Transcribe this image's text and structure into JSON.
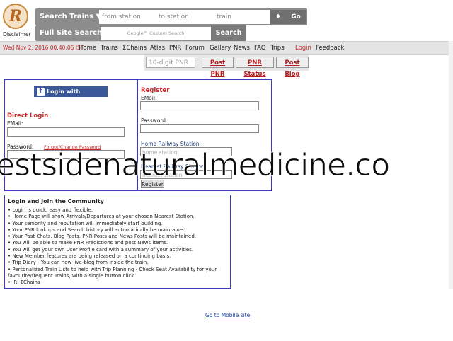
{
  "header": {
    "logo_letter": "R",
    "disclaimer": "Disclaimer",
    "search_trains_label": "Search Trains ▼",
    "from_placeholder": "from station",
    "to_placeholder": "to station",
    "train_placeholder": "train",
    "swap_label": "♦",
    "go_label": "Go",
    "full_site_search_label": "Full Site Search",
    "google_search_placeholder": "Google™ Custom Search",
    "search_button": "Search"
  },
  "nav": {
    "datetime": "Wed Nov 2, 2016 00:40:06 IST",
    "items": [
      "Home",
      "Trains",
      "ΣChains",
      "Atlas",
      "PNR",
      "Forum",
      "Gallery",
      "News",
      "FAQ",
      "Trips"
    ],
    "login": "Login",
    "feedback": "Feedback"
  },
  "pnr": {
    "placeholder": "10-digit PNR",
    "post_pnr": "Post PNR",
    "pnr_status": "PNR Status",
    "post_blog": "Post Blog"
  },
  "login": {
    "facebook_button": "Login with Facebook",
    "direct_login": "Direct Login",
    "email_label": "EMail:",
    "password_label": "Password:",
    "forgot": "Forgot/Change Password"
  },
  "register": {
    "heading": "Register",
    "email_label": "EMail:",
    "password_label": "Password:",
    "home_station_label": "Home Railway Station:",
    "home_station_placeholder": "home station",
    "nearest_station_label": "Nearest Railway Station:",
    "nearest_station_placeholder": "nearest station",
    "register_button": "Register"
  },
  "community": {
    "title": "Login and Join the Community",
    "lines": [
      "• Login is quick, easy and flexible.",
      "• Home Page will show Arrivals/Departures at your chosen Nearest Station.",
      "• Your seniority and reputation will immediately start building.",
      "• Your PNR lookups and Search history will automatically be maintained.",
      "• Your Past Chats, Blog Posts, PNR Posts and News Posts will be maintained.",
      "• You will be able to make PNR Predictions and post News items.",
      "• You will get your own User Profile card with a summary of your activities.",
      "• New Member features are being released on a continuing basis.",
      "• Trip Diary - You can now live-blog from inside the train.",
      "• Personalized Train Lists to help with Trip Planning - Check Seat Availability for your",
      "favourite/frequent Trains, with a single button click.",
      "• IRI ΣChains"
    ]
  },
  "watermark": "estsidenaturalmedicine.co",
  "footer": {
    "mobile_link": "Go to Mobile site"
  }
}
